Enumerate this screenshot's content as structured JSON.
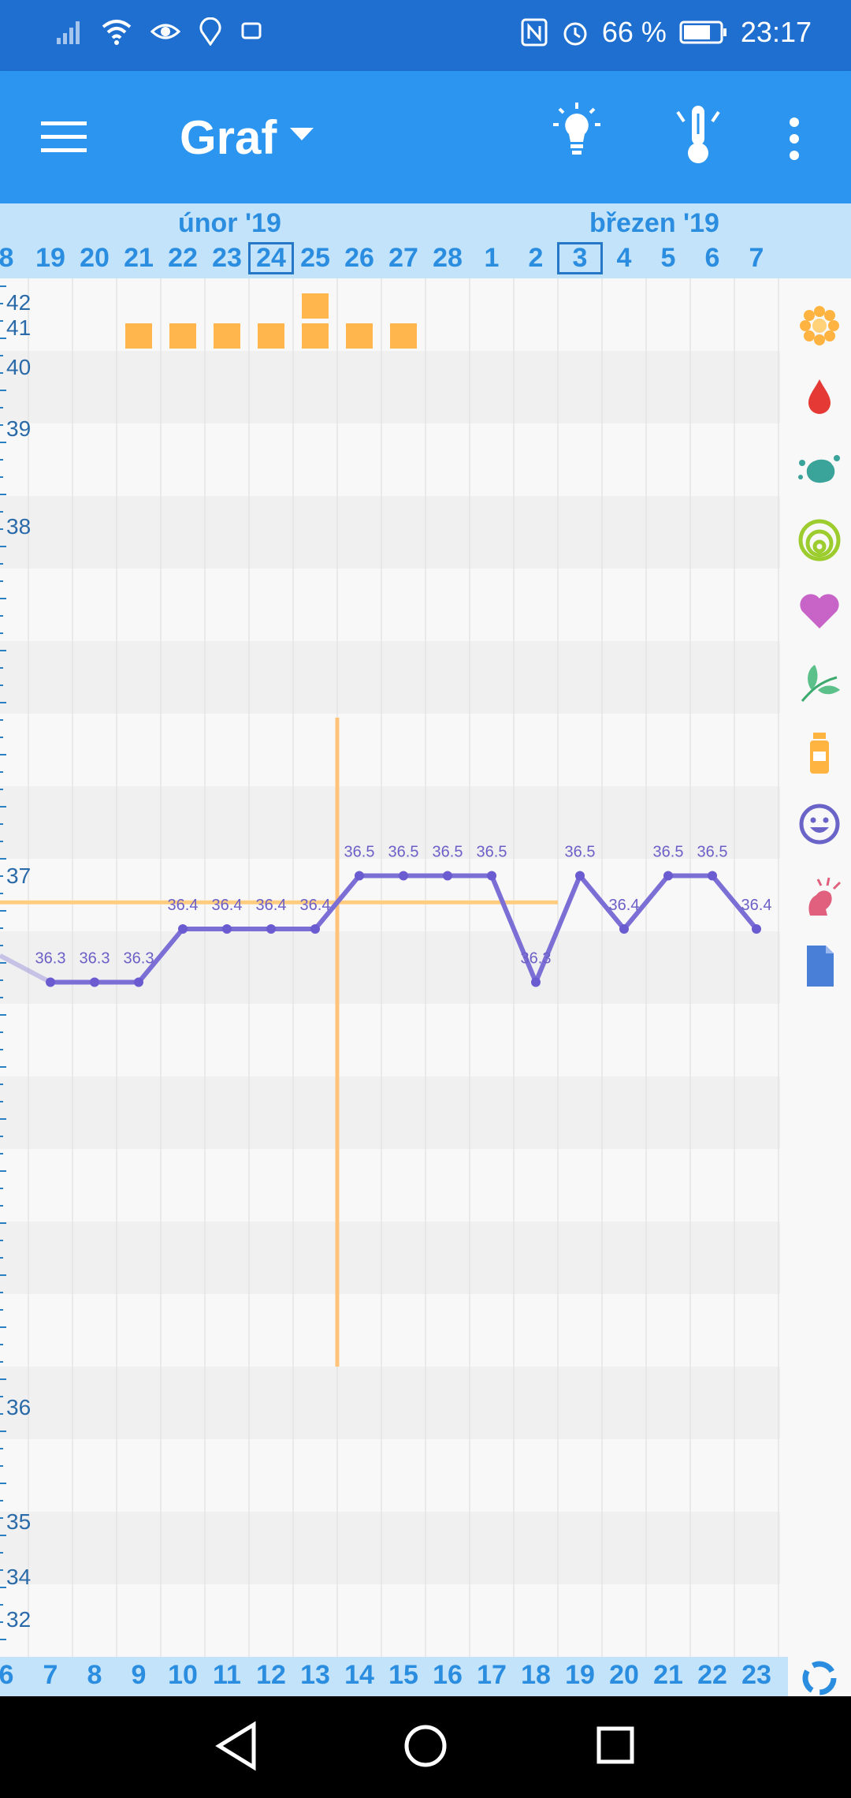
{
  "status_bar": {
    "battery_percent": "66 %",
    "time": "23:17"
  },
  "app_bar": {
    "title": "Graf"
  },
  "date_bar": {
    "month_labels": [
      "únor '19",
      "březen '19"
    ],
    "days": [
      "8",
      "19",
      "20",
      "21",
      "22",
      "23",
      "24",
      "25",
      "26",
      "27",
      "28",
      "1",
      "2",
      "3",
      "4",
      "5",
      "6",
      "7"
    ],
    "highlighted_days": [
      "24",
      "3"
    ]
  },
  "chart": {
    "y_axis_labels": [
      "42",
      "41",
      "40",
      "39",
      "38",
      "37",
      "36",
      "35",
      "34",
      "32"
    ],
    "cycle_days": [
      "6",
      "7",
      "8",
      "9",
      "10",
      "11",
      "12",
      "13",
      "14",
      "15",
      "16",
      "17",
      "18",
      "19",
      "20",
      "21",
      "22",
      "23"
    ]
  },
  "chart_data": {
    "type": "line",
    "x": [
      "7",
      "8",
      "9",
      "10",
      "11",
      "12",
      "13",
      "14",
      "15",
      "16",
      "17",
      "18",
      "19",
      "20",
      "21",
      "22",
      "23"
    ],
    "series": [
      {
        "values": [
          36.3,
          36.3,
          36.3,
          36.4,
          36.4,
          36.4,
          36.4,
          36.5,
          36.5,
          36.5,
          36.5,
          36.3,
          36.5,
          36.4,
          36.5,
          36.5,
          36.4
        ],
        "labels": [
          "36.3",
          "36.3",
          "36.3",
          "36.4",
          "36.4",
          "36.4",
          "36.4",
          "36.5",
          "36.5",
          "36.5",
          "36.5",
          "36.3",
          "36.5",
          "36.4",
          "36.5",
          "36.5",
          "36.4"
        ],
        "color": "#7b6fd6"
      }
    ],
    "cover_line": 36.45,
    "ovulation_day": "13",
    "period_days": [
      "9",
      "10",
      "11",
      "12",
      "13",
      "14",
      "15"
    ],
    "period_double_day": "13",
    "colors": {
      "period": "#ffb74d",
      "cover_line": "#ffcc80",
      "ovulation": "#ffc37a"
    }
  },
  "sidebar_icons": [
    "flower-icon",
    "blood-drop-icon",
    "splash-icon",
    "cervix-icon",
    "heart-icon",
    "leaf-icon",
    "medication-bottle-icon",
    "mood-smiley-icon",
    "pain-icon",
    "note-icon"
  ],
  "colors": {
    "status_bar": "#1e6fcf",
    "app_bar": "#2b95ef",
    "date_bar": "#c3e3fb",
    "accent_text": "#2a8de0"
  }
}
